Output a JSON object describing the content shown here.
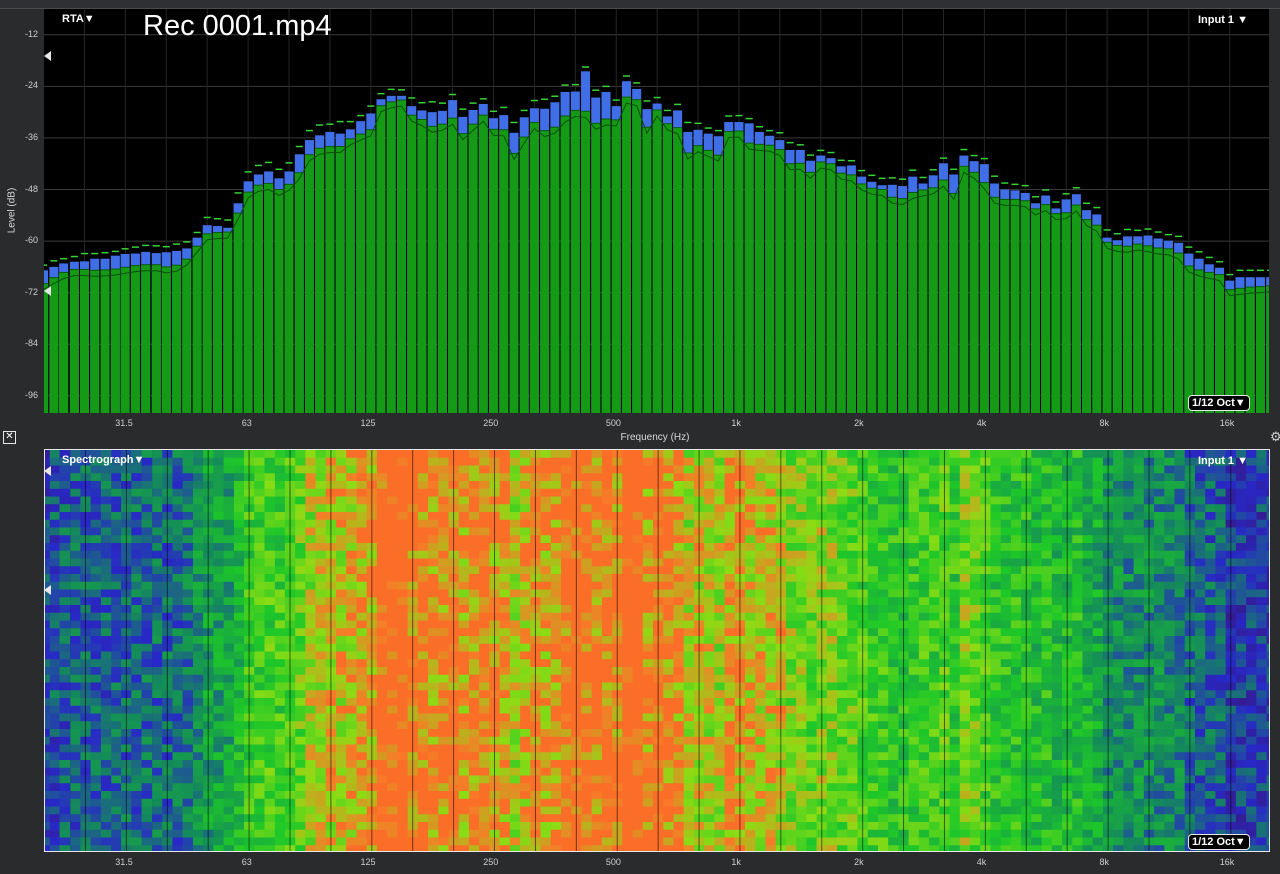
{
  "file_title": "Rec 0001.mp4",
  "rta": {
    "mode_menu": "RTA▼",
    "input_menu": "Input 1 ▼",
    "resolution_button": "1/12 Oct▼",
    "ylabel": "Level (dB)",
    "xlabel": "Frequency (Hz)",
    "y_ticks": [
      "-12",
      "-24",
      "-36",
      "-48",
      "-60",
      "-72",
      "-84",
      "-96"
    ]
  },
  "spectrograph": {
    "mode_menu": "Spectrograph▼",
    "input_menu": "Input 1 ▼",
    "resolution_button": "1/12 Oct▼"
  },
  "x_ticks": [
    "31.5",
    "63",
    "125",
    "250",
    "500",
    "1k",
    "2k",
    "4k",
    "8k",
    "16k"
  ],
  "icons": {
    "close": "close-icon",
    "gear": "gear-icon",
    "marker": "level-marker-icon"
  },
  "colors": {
    "bar": "#149a14",
    "peak_extra": "#3f6ee6",
    "peak_hold": "#35d435",
    "background": "#000000"
  },
  "chart_data": {
    "type": "bar",
    "title": "",
    "xlabel": "Frequency (Hz)",
    "ylabel": "Level (dB)",
    "x_scale": "log",
    "xlim": [
      20,
      22000
    ],
    "ylim": [
      -100,
      -6
    ],
    "grid": true,
    "bands_per_octave": 12,
    "x": [
      20,
      21.2,
      22.4,
      23.8,
      25.2,
      26.7,
      28.3,
      30,
      31.7,
      33.6,
      35.6,
      37.8,
      40,
      42.4,
      44.9,
      47.6,
      50.4,
      53.4,
      56.6,
      60,
      63.5,
      67.3,
      71.3,
      75.6,
      80,
      84.8,
      89.8,
      95.1,
      100.8,
      106.8,
      113.1,
      119.9,
      127,
      134.5,
      142.5,
      151,
      160,
      169.5,
      179.6,
      190.3,
      201.6,
      213.6,
      226.3,
      239.7,
      254,
      269.1,
      285.1,
      302.1,
      320,
      339,
      359.2,
      380.5,
      403.2,
      427.1,
      452.5,
      479.5,
      508,
      538.2,
      570.2,
      604.1,
      640,
      678.1,
      718.4,
      761.1,
      806.3,
      854.3,
      905.1,
      958.9,
      1015.9,
      1076.3,
      1140.3,
      1208.1,
      1279.9,
      1356,
      1436.6,
      1522,
      1612.5,
      1708.4,
      1810,
      1917.6,
      2031.6,
      2152.4,
      2280.4,
      2416,
      2559.6,
      2711.8,
      2873,
      3043.9,
      3224.9,
      3416.6,
      3619.8,
      3835,
      4063,
      4304.6,
      4560.6,
      4831.7,
      5119,
      5423.4,
      5745.9,
      6087.6,
      6449.5,
      6833,
      7239.3,
      7669.8,
      8125.9,
      8609,
      9121,
      9663.4,
      10238,
      10846.8,
      11491.8,
      12175.1,
      12899,
      13666,
      14478.7,
      15339.6,
      16251.7,
      17218.1,
      18241.9,
      19326.6,
      20475.9,
      21693.4
    ],
    "series": [
      {
        "values": [
          -69.9,
          -68.5,
          -67.3,
          -66.6,
          -66.6,
          -66.8,
          -66.7,
          -66.5,
          -66.1,
          -65.7,
          -65.5,
          -65.5,
          -66.0,
          -65.6,
          -64.2,
          -61.2,
          -58.3,
          -58.0,
          -57.9,
          -53.5,
          -48.6,
          -47.0,
          -46.6,
          -48.0,
          -46.8,
          -44.1,
          -39.9,
          -38.4,
          -38.0,
          -38.0,
          -36.2,
          -35.1,
          -34.1,
          -28.5,
          -27.6,
          -27.2,
          -30.7,
          -31.7,
          -33.3,
          -32.8,
          -31.4,
          -35.0,
          -32.8,
          -30.7,
          -34.0,
          -34.1,
          -39.6,
          -35.8,
          -32.4,
          -34.3,
          -33.5,
          -30.9,
          -29.6,
          -29.8,
          -32.6,
          -31.6,
          -31.8,
          -26.5,
          -27.1,
          -33.5,
          -29.5,
          -32.7,
          -33.6,
          -39.5,
          -37.8,
          -38.9,
          -40.0,
          -34.5,
          -34.4,
          -37.2,
          -37.5,
          -37.7,
          -38.7,
          -42.0,
          -41.9,
          -44.0,
          -41.6,
          -42.0,
          -44.2,
          -44.6,
          -46.7,
          -47.7,
          -48.0,
          -49.8,
          -50.1,
          -48.7,
          -48.1,
          -47.6,
          -45.8,
          -48.9,
          -42.6,
          -44.0,
          -46.4,
          -49.8,
          -50.3,
          -50.3,
          -50.6,
          -52.5,
          -51.5,
          -53.6,
          -53.4,
          -51.6,
          -55.0,
          -56.3,
          -60.3,
          -61.0,
          -61.2,
          -60.7,
          -61.1,
          -61.6,
          -61.8,
          -62.8,
          -65.8,
          -66.7,
          -67.3,
          -67.8,
          -71.3,
          -71.0,
          -70.7,
          -70.6,
          -70.4
        ]
      },
      {
        "values": [
          -66.8,
          -66.0,
          -65.2,
          -64.8,
          -64.7,
          -64.1,
          -64.1,
          -63.4,
          -63.0,
          -62.9,
          -62.5,
          -62.8,
          -62.6,
          -62.3,
          -61.7,
          -59.2,
          -56.3,
          -56.5,
          -56.9,
          -51.2,
          -46.1,
          -44.5,
          -43.8,
          -45.4,
          -43.8,
          -39.8,
          -36.5,
          -35.4,
          -34.6,
          -35.0,
          -34.0,
          -32.1,
          -30.3,
          -27.0,
          -26.2,
          -26.2,
          -28.6,
          -29.6,
          -30.0,
          -29.7,
          -27.2,
          -31.1,
          -29.5,
          -28.1,
          -31.4,
          -30.7,
          -34.8,
          -31.2,
          -29.1,
          -29.2,
          -27.7,
          -25.3,
          -25.2,
          -20.5,
          -26.6,
          -25.3,
          -28.6,
          -22.8,
          -24.6,
          -29.3,
          -28.0,
          -31.0,
          -29.6,
          -34.6,
          -34.1,
          -35.0,
          -35.6,
          -32.3,
          -32.3,
          -32.6,
          -34.6,
          -35.5,
          -36.5,
          -38.8,
          -38.8,
          -41.3,
          -40.1,
          -40.7,
          -42.6,
          -42.4,
          -45.0,
          -46.2,
          -47.0,
          -46.9,
          -47.2,
          -45.0,
          -46.6,
          -44.7,
          -41.9,
          -44.5,
          -40.1,
          -41.4,
          -42.1,
          -46.6,
          -48.0,
          -48.2,
          -48.8,
          -51.2,
          -49.4,
          -52.4,
          -50.3,
          -49.1,
          -52.8,
          -53.8,
          -59.2,
          -59.8,
          -58.9,
          -58.9,
          -58.7,
          -59.4,
          -59.9,
          -60.4,
          -62.9,
          -64.1,
          -65.4,
          -66.2,
          -69.2,
          -68.4,
          -68.4,
          -68.4,
          -68.4
        ]
      },
      {
        "values": [
          -65.6,
          -64.6,
          -64.1,
          -63.6,
          -62.9,
          -62.9,
          -62.7,
          -62.4,
          -61.8,
          -61.4,
          -61.0,
          -61.1,
          -61.3,
          -60.7,
          -60.2,
          -58.0,
          -54.5,
          -54.8,
          -55.1,
          -48.8,
          -43.9,
          -42.4,
          -41.7,
          -43.3,
          -41.8,
          -38.0,
          -34.3,
          -33.0,
          -32.8,
          -32.2,
          -32.2,
          -30.8,
          -28.6,
          -25.7,
          -24.7,
          -24.8,
          -26.7,
          -27.8,
          -27.6,
          -27.9,
          -25.9,
          -29.3,
          -27.9,
          -26.9,
          -29.8,
          -28.9,
          -32.4,
          -29.6,
          -27.3,
          -27.0,
          -26.3,
          -23.7,
          -23.6,
          -19.5,
          -24.9,
          -24.0,
          -27.2,
          -21.6,
          -23.2,
          -27.4,
          -26.6,
          -29.6,
          -28.2,
          -32.4,
          -32.6,
          -33.7,
          -34.3,
          -30.9,
          -30.8,
          -31.5,
          -33.4,
          -34.3,
          -34.8,
          -37.1,
          -37.6,
          -40.0,
          -38.9,
          -39.4,
          -41.2,
          -41.3,
          -43.6,
          -44.7,
          -45.4,
          -45.3,
          -45.6,
          -43.5,
          -45.2,
          -43.4,
          -40.7,
          -43.3,
          -38.7,
          -40.1,
          -40.8,
          -44.9,
          -46.5,
          -46.8,
          -47.1,
          -49.7,
          -48.1,
          -50.9,
          -49.0,
          -47.6,
          -51.2,
          -52.2,
          -57.4,
          -58.3,
          -57.3,
          -57.5,
          -57.2,
          -57.9,
          -58.5,
          -58.9,
          -61.4,
          -62.5,
          -63.8,
          -64.8,
          -67.8,
          -66.8,
          -66.8,
          -66.8,
          -66.8
        ]
      }
    ],
    "series_roles": [
      "current level",
      "peak level",
      "peak hold"
    ],
    "annotations": [
      "Rec 0001.mp4"
    ]
  }
}
